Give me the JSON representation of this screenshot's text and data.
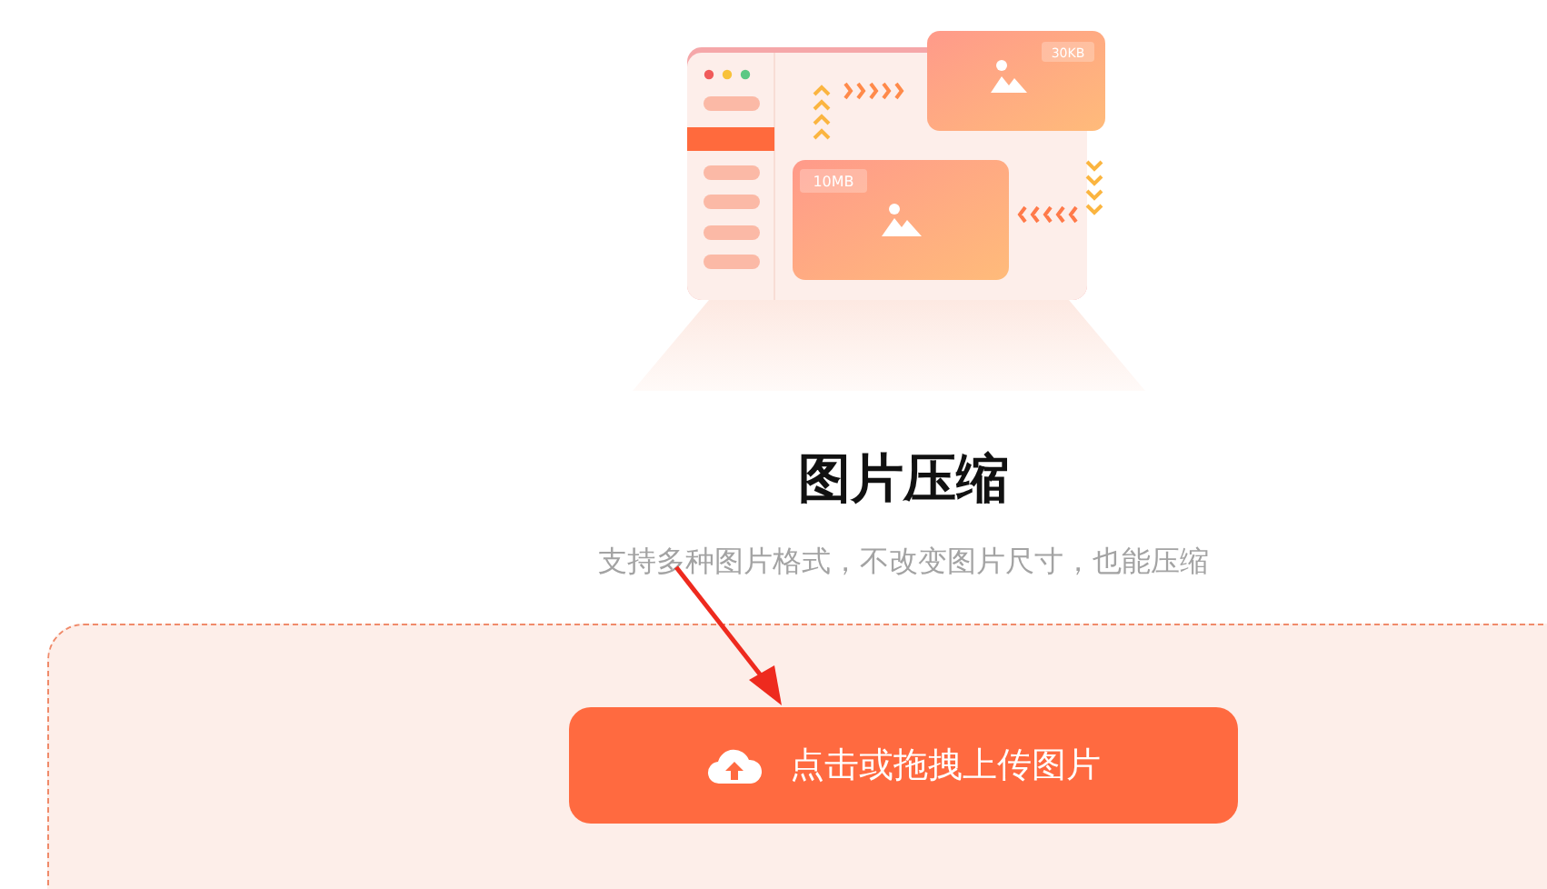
{
  "illustration": {
    "large_size": "10MB",
    "small_size": "30KB"
  },
  "title": "图片压缩",
  "subtitle": "支持多种图片格式，不改变图片尺寸，也能压缩",
  "upload": {
    "button": "点击或拖拽上传图片"
  }
}
